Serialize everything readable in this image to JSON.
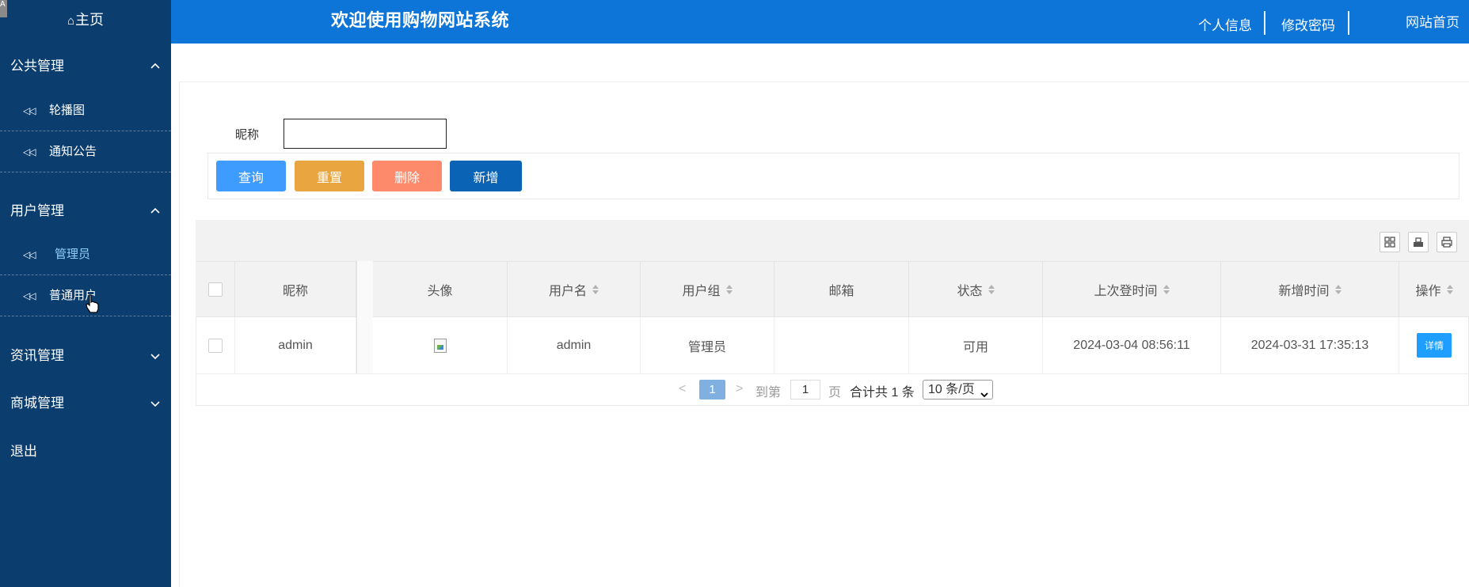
{
  "sidebar": {
    "corner_tag": "A",
    "home": "主页",
    "groups": [
      {
        "title": "公共管理",
        "expanded": true,
        "items": [
          {
            "label": "轮播图"
          },
          {
            "label": "通知公告"
          }
        ]
      },
      {
        "title": "用户管理",
        "expanded": true,
        "items": [
          {
            "label": "管理员",
            "active": true
          },
          {
            "label": "普通用户"
          }
        ]
      },
      {
        "title": "资讯管理",
        "expanded": false
      },
      {
        "title": "商城管理",
        "expanded": false
      }
    ],
    "logout": "退出"
  },
  "header": {
    "title": "欢迎使用购物网站系统",
    "links": [
      "个人信息",
      "修改密码",
      "网站首页"
    ]
  },
  "search": {
    "label": "昵称",
    "value": "",
    "buttons": {
      "query": "查询",
      "reset": "重置",
      "delete": "删除",
      "add": "新增"
    }
  },
  "table": {
    "columns": [
      "昵称",
      "头像",
      "用户名",
      "用户组",
      "邮箱",
      "状态",
      "上次登时间",
      "新增时间",
      "操作"
    ],
    "rows": [
      {
        "nickname": "admin",
        "avatar": "",
        "username": "admin",
        "group": "管理员",
        "email": "",
        "status": "可用",
        "last_login": "2024-03-04 08:56:11",
        "created": "2024-03-31 17:35:13",
        "action": "详情"
      }
    ]
  },
  "pager": {
    "current": "1",
    "goto_label": "到第",
    "goto_value": "1",
    "page_label": "页",
    "total": "合计共 1 条",
    "per_page": "10 条/页"
  },
  "colors": {
    "sidebar_bg": "#0b3d6e",
    "header_bg": "#0d74d8",
    "btn_query": "#3f9cff",
    "btn_reset": "#e8a540",
    "btn_delete": "#fd8a6a",
    "btn_add": "#0b63b6",
    "active_item": "#8fd0ff"
  }
}
